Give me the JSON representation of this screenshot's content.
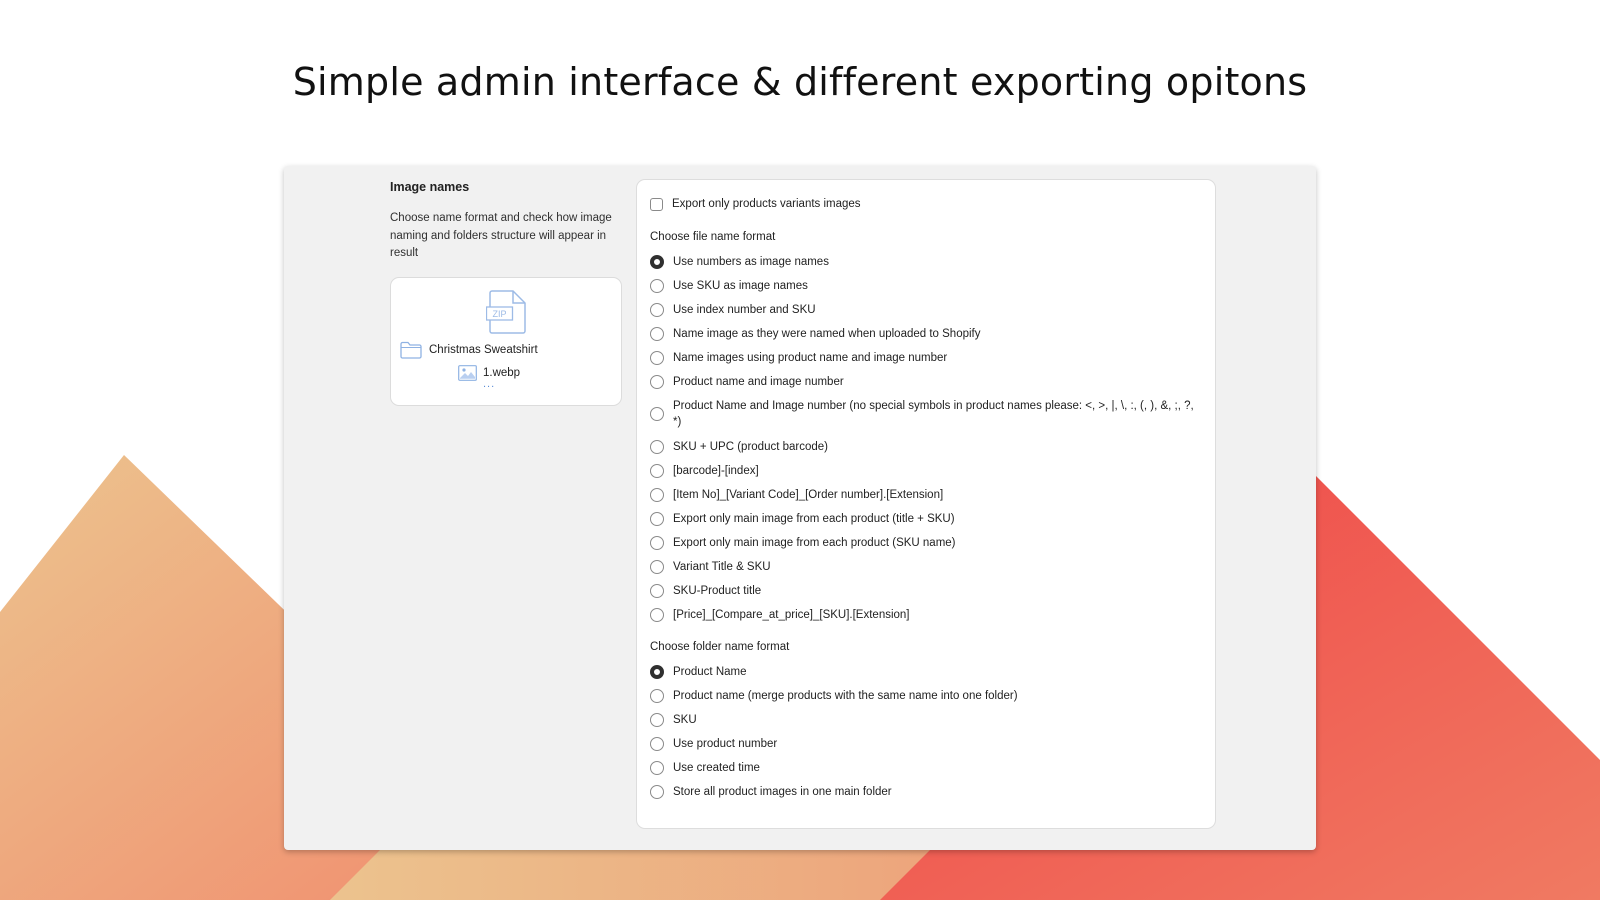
{
  "page": {
    "headline": "Simple admin interface & different exporting opitons"
  },
  "colors": {
    "gradient_warm_start": "#ecc38e",
    "gradient_warm_end": "#f18a6c",
    "gradient_red_start": "#ef4446",
    "gradient_red_end": "#f07a62",
    "selected_radio": "#303030"
  },
  "settings": {
    "section_title": "Image names",
    "section_description": "Choose name format and check how image naming and folders structure will appear in result",
    "preview": {
      "archive_icon": "zip-file-icon",
      "archive_icon_text": "ZIP",
      "folder_name": "Christmas Sweatshirt",
      "file_name": "1.webp",
      "more": "..."
    },
    "export_variants_label": "Export only products variants images",
    "file_format_title": "Choose file name format",
    "file_format_options": [
      {
        "label": "Use numbers as image names",
        "checked": true
      },
      {
        "label": "Use SKU as image names",
        "checked": false
      },
      {
        "label": "Use index number and SKU",
        "checked": false
      },
      {
        "label": "Name image as they were named when uploaded to Shopify",
        "checked": false
      },
      {
        "label": "Name images using product name and image number",
        "checked": false
      },
      {
        "label": "Product name and image number",
        "checked": false
      },
      {
        "label": "Product Name and Image number (no special symbols in product names please: <, >, |, \\, :, (, ), &, ;, ?, *)",
        "checked": false
      },
      {
        "label": "SKU + UPC (product barcode)",
        "checked": false
      },
      {
        "label": "[barcode]-[index]",
        "checked": false
      },
      {
        "label": "[Item No]_[Variant Code]_[Order number].[Extension]",
        "checked": false
      },
      {
        "label": "Export only main image from each product (title + SKU)",
        "checked": false
      },
      {
        "label": "Export only main image from each product (SKU name)",
        "checked": false
      },
      {
        "label": "Variant Title & SKU",
        "checked": false
      },
      {
        "label": "SKU-Product title",
        "checked": false
      },
      {
        "label": "[Price]_[Compare_at_price]_[SKU].[Extension]",
        "checked": false
      }
    ],
    "folder_format_title": "Choose folder name format",
    "folder_format_options": [
      {
        "label": "Product Name",
        "checked": true
      },
      {
        "label": "Product name (merge products with the same name into one folder)",
        "checked": false
      },
      {
        "label": "SKU",
        "checked": false
      },
      {
        "label": "Use product number",
        "checked": false
      },
      {
        "label": "Use created time",
        "checked": false
      },
      {
        "label": "Store all product images in one main folder",
        "checked": false
      }
    ]
  }
}
